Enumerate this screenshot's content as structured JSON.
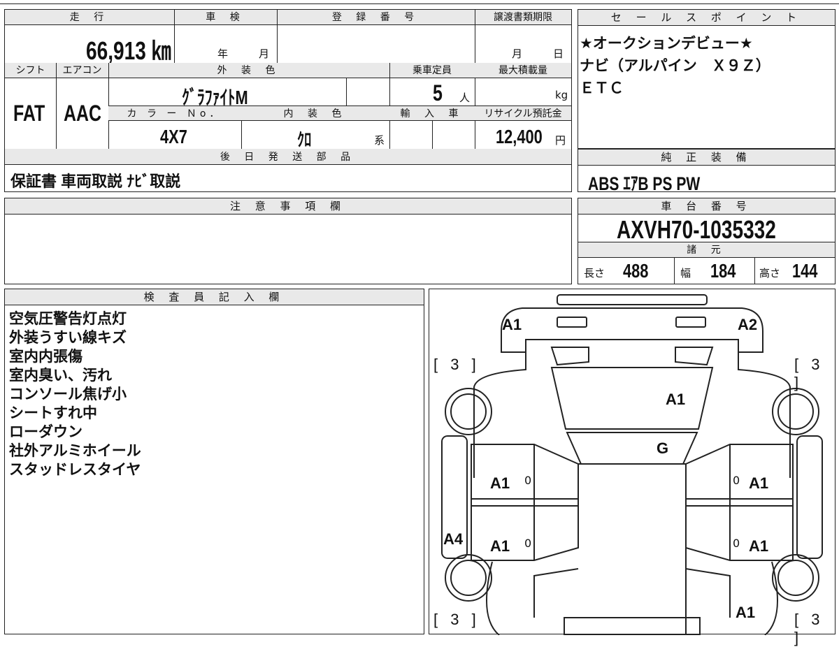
{
  "spec": {
    "mileage": {
      "header": "走 行",
      "value": "66,913 ㎞"
    },
    "inspection": {
      "header": "車 検",
      "year_unit": "年",
      "month_unit": "月"
    },
    "registration": {
      "header": "登 録 番 号"
    },
    "transfer_deadline": {
      "header": "譲渡書類期限",
      "month_unit": "月",
      "day_unit": "日"
    },
    "shift": {
      "header": "シフト",
      "value": "FAT"
    },
    "aircon": {
      "header": "エアコン",
      "value": "AAC"
    },
    "exterior_color": {
      "header": "外 装 色",
      "value": "ｸﾞﾗﾌｧｲﾄM"
    },
    "capacity": {
      "header": "乗車定員",
      "value": "5",
      "unit": "人"
    },
    "max_load": {
      "header": "最大積載量",
      "unit": "kg"
    },
    "color_no": {
      "header": "カ ラ ー Ｎo．",
      "value": "4X7"
    },
    "interior_color": {
      "header": "内 装 色",
      "value": "ｸﾛ",
      "suffix": "系"
    },
    "import": {
      "header": "輸 入 車"
    },
    "recycle": {
      "header": "リサイクル預託金",
      "value": "12,400",
      "unit": "円"
    },
    "later_parts": {
      "header": "後 日 発 送 部 品",
      "value": "保証書 車両取説 ﾅﾋﾞ取説"
    },
    "notes": {
      "header": "注 意 事 項 欄"
    }
  },
  "sales": {
    "header": "セ ー ル ス ポ イ ン ト",
    "lines": [
      "★オークションデビュー★",
      "ナビ（アルパイン　Ｘ９Ｚ）",
      "ＥＴＣ"
    ]
  },
  "equipment": {
    "header": "純 正 装 備",
    "value": "ABS ｴｱB PS PW"
  },
  "chassis": {
    "header": "車 台 番 号",
    "value": "AXVH70-1035332"
  },
  "dimensions": {
    "header": "諸 元",
    "length_label": "長さ",
    "length": "488",
    "width_label": "幅",
    "width": "184",
    "height_label": "高さ",
    "height": "144"
  },
  "inspector": {
    "header": "検 査 員 記 入 欄",
    "lines": [
      "空気圧警告灯点灯",
      "外装うすい線キズ",
      "室内内張傷",
      "室内臭い、汚れ",
      "コンソール焦げ小",
      "シートすれ中",
      "ローダウン",
      "社外アルミホイール",
      "スタッドレスタイヤ"
    ]
  },
  "diagram": {
    "front_left": "A1",
    "front_right": "A2",
    "hood": "A1",
    "windshield": "G",
    "front_door_left": "A1",
    "front_door_right": "A1",
    "rear_door_left": "A1",
    "rear_door_right": "A1",
    "left_side": "A4",
    "rear_right": "A1",
    "door_small": "0",
    "tire_front_left": "[ 3 ]",
    "tire_front_right": "[ 3 ]",
    "tire_rear_left": "[ 3 ]",
    "tire_rear_right": "[ 3 ]"
  }
}
